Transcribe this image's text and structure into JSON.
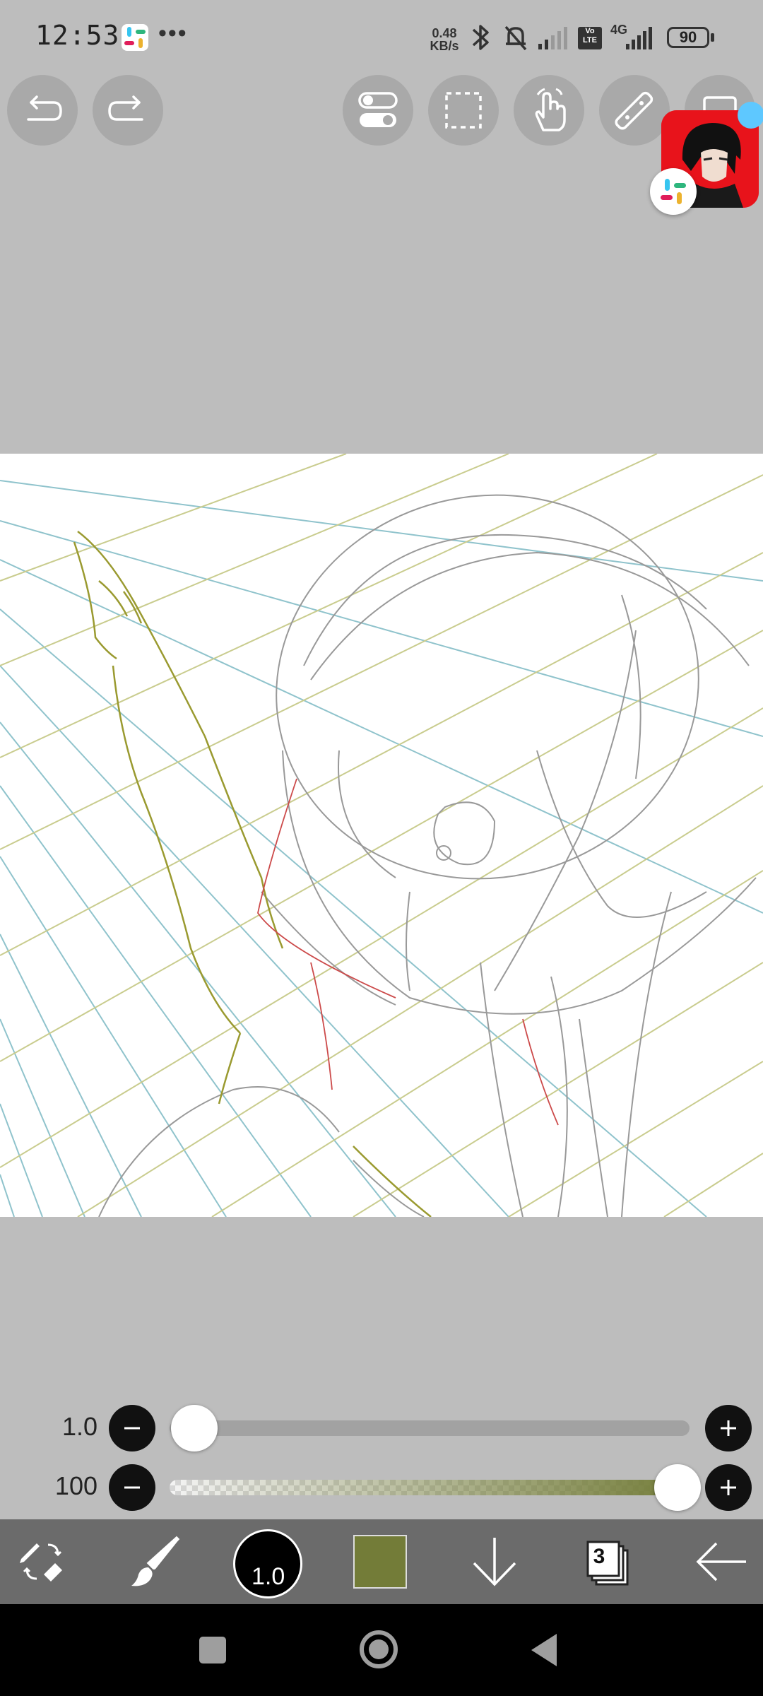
{
  "status_bar": {
    "time": "12:53",
    "more_dots": "•••",
    "net_speed_value": "0.48",
    "net_speed_unit": "KB/s",
    "network_label_4g": "4G",
    "volte_label": "Vo LTE",
    "battery_level": "90"
  },
  "toolbar": {
    "undo": "undo",
    "redo": "redo",
    "icons": [
      "toggle-icon",
      "selection-icon",
      "hand-icon",
      "ruler-icon",
      "image-icon"
    ]
  },
  "sliders": {
    "brush_size_value": "1.0",
    "brush_size_fraction": 0.0,
    "opacity_value": "100",
    "opacity_fraction": 1.0
  },
  "bottom_toolbar": {
    "brush_size_label": "1.0",
    "current_color": "#737c38",
    "layer_count": "3"
  },
  "colors": {
    "background": "#bdbdbd",
    "perspective_blue": "#8fc3cc",
    "perspective_yellow": "#c9cc8e",
    "sketch_gray": "#999999",
    "sketch_olive": "#9a9a30",
    "sketch_red": "#cc4a4a"
  }
}
